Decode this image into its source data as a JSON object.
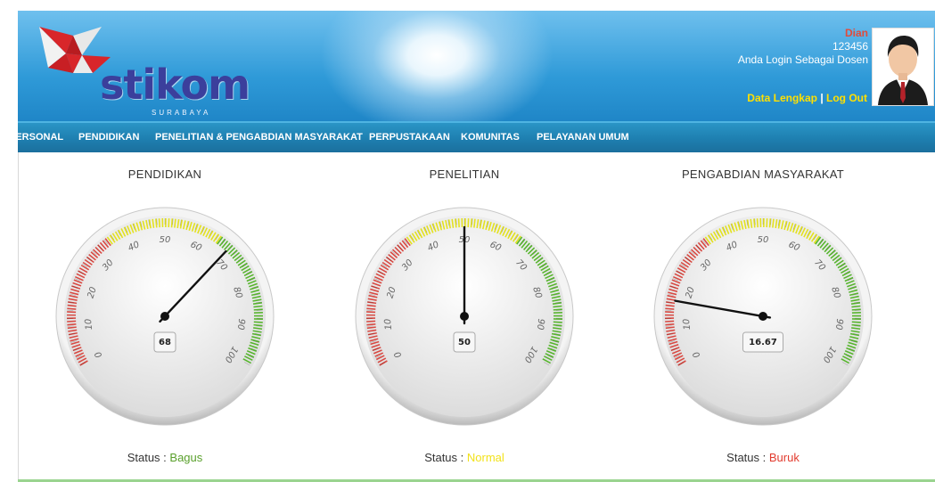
{
  "header": {
    "logo": {
      "text": "stikom",
      "subtitle": "SURABAYA"
    },
    "user": {
      "name": "Dian",
      "id": "123456",
      "role": "Anda Login Sebagai Dosen",
      "link_detail": "Data Lengkap",
      "separator": "|",
      "link_logout": "Log Out"
    }
  },
  "nav": {
    "items": [
      {
        "label": "PERSONAL"
      },
      {
        "label": "PENDIDIKAN"
      },
      {
        "label": "PENELITIAN & PENGABDIAN MASYARAKAT"
      },
      {
        "label": "PERPUSTAKAAN"
      },
      {
        "label": "KOMUNITAS"
      },
      {
        "label": "PELAYANAN UMUM"
      }
    ]
  },
  "gauges": [
    {
      "title": "PENDIDIKAN",
      "value": 68,
      "value_label": "68",
      "status_prefix": "Status : ",
      "status": "Bagus",
      "status_color": "#5aa02c"
    },
    {
      "title": "PENELITIAN",
      "value": 50,
      "value_label": "50",
      "status_prefix": "Status : ",
      "status": "Normal",
      "status_color": "#f2e21a"
    },
    {
      "title": "PENGABDIAN MASYARAKAT",
      "value": 16.67,
      "value_label": "16.67",
      "status_prefix": "Status : ",
      "status": "Buruk",
      "status_color": "#e23b2e"
    }
  ],
  "gauge_scale": {
    "min": 0,
    "max": 100,
    "tick_labels": [
      "0",
      "10",
      "20",
      "30",
      "40",
      "50",
      "60",
      "70",
      "80",
      "90",
      "100"
    ],
    "bands": [
      {
        "from": 0,
        "to": 35,
        "color": "#d84a43"
      },
      {
        "from": 35,
        "to": 65,
        "color": "#e3e11f"
      },
      {
        "from": 65,
        "to": 100,
        "color": "#58b52f"
      }
    ]
  },
  "colors": {
    "header_blue": "#2f9ad8",
    "nav_blue": "#1e7fb0",
    "user_name": "#e14b3b",
    "links": "#ffe000"
  }
}
